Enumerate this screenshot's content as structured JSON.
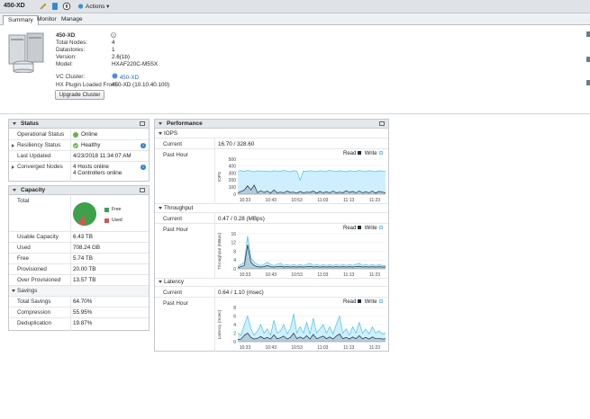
{
  "toolbar": {
    "title": "450-XD",
    "actions_label": "Actions"
  },
  "tabs": [
    "Summary",
    "Monitor",
    "Manage"
  ],
  "summary": {
    "name": "450-XD",
    "rows": [
      {
        "label": "Total Nodes:",
        "value": "4"
      },
      {
        "label": "Datastores:",
        "value": "1"
      },
      {
        "label": "Version:",
        "value": "2.6(1b)"
      },
      {
        "label": "Model:",
        "value": "HXAF220C-M5SX"
      }
    ],
    "vc_cluster_label": "VC Cluster:",
    "vc_cluster_value": "450-XD",
    "plugin_label": "HX Plugin Loaded From:",
    "plugin_value": "450-XD (10.10.40.100)",
    "upgrade_button": "Upgrade Cluster"
  },
  "status": {
    "title": "Status",
    "operational_label": "Operational Status",
    "operational_value": "Online",
    "resiliency_label": "Resiliency Status",
    "resiliency_value": "Healthy",
    "updated_label": "Last Updated",
    "updated_value": "4/23/2018 11:34:07 AM",
    "converged_label": "Converged Nodes",
    "converged_hosts": "4 Hosts online",
    "converged_controllers": "4 Controllers online"
  },
  "capacity": {
    "title": "Capacity",
    "total_label": "Total",
    "legend_free": "Free",
    "legend_used": "Used",
    "free_fraction": 0.9,
    "rows": [
      {
        "label": "Usable Capacity",
        "value": "6.43 TB"
      },
      {
        "label": "Used",
        "value": "708.24 GB"
      },
      {
        "label": "Free",
        "value": "5.74 TB"
      },
      {
        "label": "Provisioned",
        "value": "20.00 TB"
      },
      {
        "label": "Over Provisioned",
        "value": "13.57 TB"
      }
    ],
    "savings_label": "Savings",
    "savings_rows": [
      {
        "label": "Total Savings",
        "value": "64.70%"
      },
      {
        "label": "Compression",
        "value": "55.95%"
      },
      {
        "label": "Deduplication",
        "value": "19.87%"
      }
    ]
  },
  "performance": {
    "title": "Performance",
    "current_label": "Current",
    "past_hour_label": "Past Hour",
    "read_label": "Read",
    "write_label": "Write",
    "sections": [
      {
        "title": "IOPS",
        "current": "16.70 / 328.60"
      },
      {
        "title": "Throughput",
        "current": "0.47 / 0.28  (MBps)"
      },
      {
        "title": "Latency",
        "current": "0.64 / 1.10  (msec)"
      }
    ]
  },
  "colors": {
    "online": "#6ab04c",
    "free": "#3ca14a",
    "used": "#d9534f",
    "write": "#6fd0f0",
    "read": "#1c2c3c",
    "info": "#2d7fc7"
  },
  "chart_data": [
    {
      "type": "area",
      "ylabel": "IOPS",
      "x": [
        "10:33",
        "10:43",
        "10:53",
        "11:03",
        "11:13",
        "11:23"
      ],
      "ylim": [
        0,
        500
      ],
      "yticks": [
        0,
        100,
        200,
        300,
        400,
        500
      ],
      "series": [
        {
          "name": "Write",
          "values": [
            330,
            335,
            325,
            340,
            330,
            320,
            335,
            330,
            325,
            330,
            320,
            335,
            330,
            325,
            340,
            330,
            320,
            335,
            330,
            200,
            330,
            325,
            335,
            330,
            320,
            335,
            330,
            325,
            340,
            330,
            325,
            335,
            330,
            320,
            335,
            330,
            325,
            340,
            330,
            325,
            335,
            330,
            320,
            335,
            330,
            330
          ]
        },
        {
          "name": "Read",
          "values": [
            20,
            40,
            60,
            120,
            60,
            130,
            20,
            50,
            25,
            45,
            15,
            60,
            20,
            30,
            20,
            45,
            25,
            30,
            15,
            40,
            20,
            30,
            25,
            45,
            15,
            40,
            20,
            35,
            20,
            45,
            20,
            30,
            20,
            50,
            25,
            40,
            20,
            45,
            20,
            35,
            20,
            45,
            15,
            40,
            30,
            20
          ]
        }
      ]
    },
    {
      "type": "area",
      "ylabel": "Throughput (MBps)",
      "x": [
        "10:33",
        "10:43",
        "10:53",
        "11:03",
        "11:13",
        "11:23"
      ],
      "ylim": [
        0,
        16
      ],
      "yticks": [
        0,
        4,
        8,
        12,
        16
      ],
      "series": [
        {
          "name": "Write",
          "values": [
            1,
            2,
            3,
            15,
            5,
            3,
            2,
            1.5,
            2,
            3,
            2,
            1.5,
            2,
            2.5,
            1.5,
            2,
            1.5,
            2,
            1.5,
            2,
            1.5,
            2,
            2.5,
            1.5,
            2,
            1.5,
            2,
            1.5,
            2,
            1.5,
            2,
            1.5,
            2,
            1.5,
            2,
            1.5,
            2,
            2.5,
            1.5,
            2,
            1.5,
            2,
            1.5,
            2,
            1.5,
            1.5
          ]
        },
        {
          "name": "Read",
          "values": [
            0.5,
            1,
            1.5,
            11,
            3,
            1.5,
            1,
            0.8,
            1,
            1.5,
            1,
            0.8,
            1,
            1.2,
            0.8,
            1,
            0.8,
            1,
            0.8,
            1,
            0.8,
            1,
            1.2,
            0.8,
            1,
            0.8,
            1,
            0.8,
            1,
            0.8,
            1,
            0.8,
            1,
            0.8,
            1,
            0.8,
            1,
            1.2,
            0.8,
            1,
            0.8,
            1,
            0.8,
            1,
            0.8,
            0.8
          ]
        }
      ]
    },
    {
      "type": "area",
      "ylabel": "Latency (msec)",
      "x": [
        "10:33",
        "10:43",
        "10:53",
        "11:03",
        "11:13",
        "11:23"
      ],
      "ylim": [
        0,
        8
      ],
      "yticks": [
        0,
        2,
        4,
        6,
        8
      ],
      "series": [
        {
          "name": "Write",
          "values": [
            2,
            1.5,
            4,
            6,
            3,
            1.5,
            2.5,
            4,
            2,
            3,
            1.5,
            5,
            2,
            2.5,
            4,
            1.8,
            3,
            6.5,
            2,
            3.5,
            2,
            4.5,
            1.8,
            5.5,
            2,
            3,
            4,
            2,
            3.5,
            1.8,
            4,
            6,
            2,
            3,
            1.5,
            3.5,
            2,
            4.5,
            2,
            3,
            1.8,
            3.5,
            2,
            2.5,
            1.8,
            2
          ]
        },
        {
          "name": "Read",
          "values": [
            0.5,
            0.6,
            1.5,
            2,
            1,
            0.6,
            0.8,
            1.2,
            0.7,
            1,
            0.6,
            1.6,
            0.7,
            0.9,
            1.3,
            0.6,
            1,
            2,
            0.7,
            1.1,
            0.7,
            1.4,
            0.6,
            1.7,
            0.7,
            1,
            1.3,
            0.7,
            1.1,
            0.6,
            1.3,
            1.8,
            0.7,
            1,
            0.6,
            1.1,
            0.7,
            1.4,
            0.7,
            1,
            0.6,
            1.1,
            0.7,
            0.8,
            0.6,
            0.7
          ]
        }
      ]
    }
  ]
}
